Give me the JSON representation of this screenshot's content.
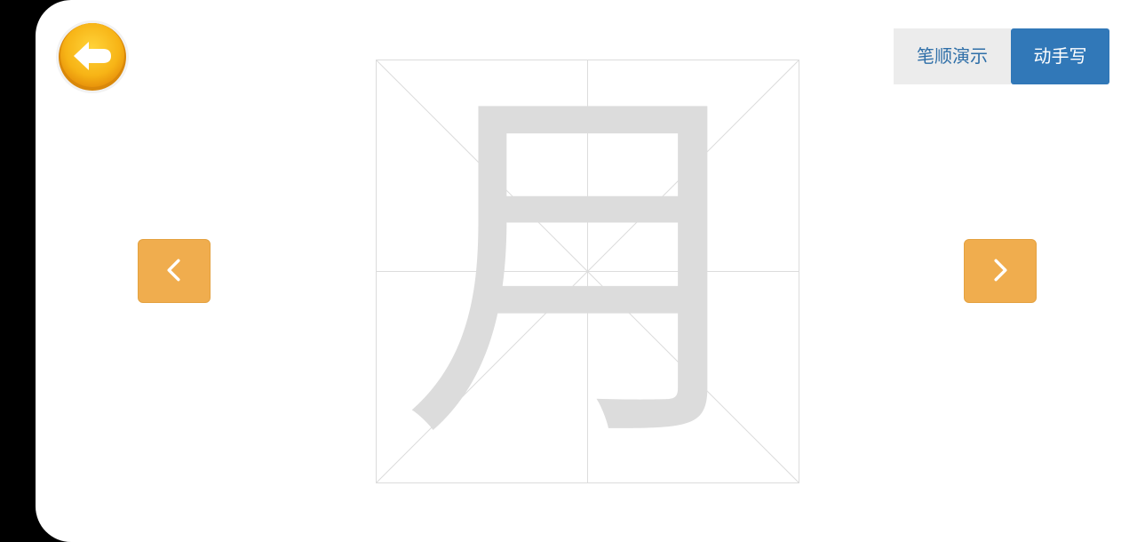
{
  "header": {
    "back_icon": "back-arrow-icon",
    "modes": {
      "stroke_order_label": "笔顺演示",
      "handwrite_label": "动手写",
      "active": "handwrite"
    }
  },
  "main": {
    "character": "月",
    "prev_icon": "chevron-left-icon",
    "next_icon": "chevron-right-icon"
  },
  "colors": {
    "accent_orange": "#f0ad4e",
    "active_blue": "#3178b8",
    "inactive_gray": "#ececec",
    "character_gray": "#dcdcdc",
    "grid_line": "#dcdcdc"
  }
}
